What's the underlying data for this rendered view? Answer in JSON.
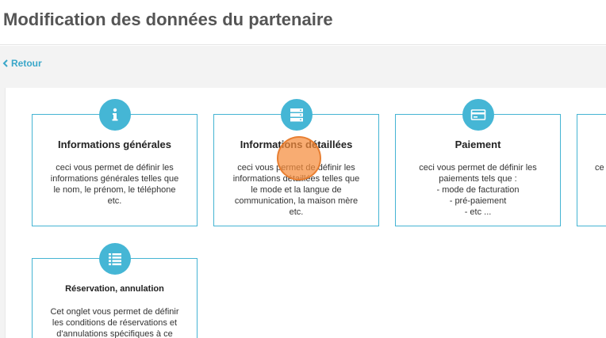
{
  "header": {
    "title": "Modification des données du partenaire"
  },
  "nav": {
    "back_label": "Retour"
  },
  "cards": [
    {
      "title": "Informations générales",
      "icon": "info-icon",
      "lines": [
        "ceci vous permet de définir les",
        "informations générales telles que",
        "le nom, le prénom, le téléphone",
        "etc."
      ]
    },
    {
      "title": "Informations détaillées",
      "icon": "server-icon",
      "lines": [
        "ceci vous permet de définir les",
        "informations détaillées telles que",
        "le mode et la langue de",
        "communication, la maison mère",
        "etc."
      ]
    },
    {
      "title": "Paiement",
      "icon": "credit-card-icon",
      "lines": [
        "ceci vous permet de définir les",
        "paiements tels que :",
        "- mode de facturation",
        "- pré-paiement",
        "- etc ..."
      ]
    },
    {
      "title": "",
      "icon": "",
      "lines": [
        "ce"
      ]
    },
    {
      "title": "Réservation, annulation",
      "icon": "list-icon",
      "lines": [
        "Cet onglet vous permet de définir",
        "les conditions de réservations et",
        "d'annulations spécifiques à ce"
      ]
    }
  ],
  "colors": {
    "accent": "#45b6d5",
    "link": "#3aa7c9",
    "cursor": "#f58c3c"
  }
}
